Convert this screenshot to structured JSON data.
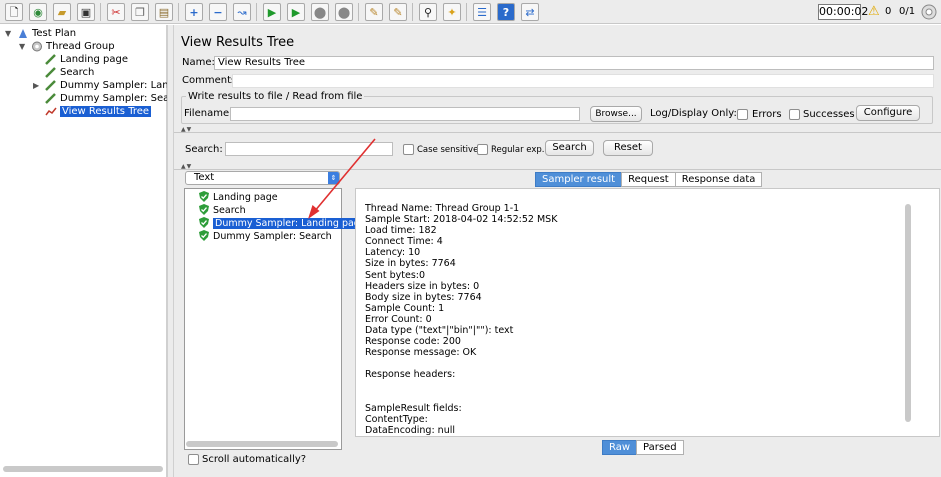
{
  "toolbar": {
    "buttons": [
      "new-icon",
      "templates-icon",
      "open-icon",
      "save-icon",
      "cut-icon",
      "copy-icon",
      "paste-icon",
      "expand-icon",
      "collapse-icon",
      "toggle-icon",
      "start-icon",
      "start-no-pause-icon",
      "stop-icon",
      "shutdown-icon",
      "clear-icon",
      "clear-all-icon",
      "search-icon",
      "reset-search-icon",
      "function-helper-icon",
      "help-icon",
      "remote-icon"
    ],
    "timer": "00:00:02",
    "warnings": "0",
    "threads": "0/1"
  },
  "tree": {
    "items": [
      {
        "label": "Test Plan",
        "icon": "test-plan-icon"
      },
      {
        "label": "Thread Group",
        "icon": "thread-group-icon"
      },
      {
        "label": "Landing page",
        "icon": "sampler-icon"
      },
      {
        "label": "Search",
        "icon": "sampler-icon"
      },
      {
        "label": "Dummy Sampler: Landing",
        "icon": "sampler-icon"
      },
      {
        "label": "Dummy Sampler: Search",
        "icon": "sampler-icon"
      },
      {
        "label": "View Results Tree",
        "icon": "listener-icon"
      }
    ]
  },
  "panel": {
    "title": "View Results Tree",
    "name_label": "Name:",
    "name_value": "View Results Tree",
    "comments_label": "Comments:",
    "comments_value": "",
    "write_legend": "Write results to file / Read from file",
    "filename_label": "Filename",
    "filename_value": "",
    "browse": "Browse...",
    "log_display_label": "Log/Display Only:",
    "errors_label": "Errors",
    "successes_label": "Successes",
    "configure": "Configure"
  },
  "search": {
    "label": "Search:",
    "value": "",
    "case_sensitive": "Case sensitive",
    "regular_exp": "Regular exp.",
    "search_button": "Search",
    "reset_button": "Reset"
  },
  "renderer": {
    "selected": "Text"
  },
  "results": [
    {
      "label": "Landing page",
      "status": "success"
    },
    {
      "label": "Search",
      "status": "success"
    },
    {
      "label": "Dummy Sampler: Landing page",
      "status": "success",
      "selected": true
    },
    {
      "label": "Dummy Sampler: Search",
      "status": "success"
    }
  ],
  "scroll_auto": "Scroll automatically?",
  "tabs": [
    "Sampler result",
    "Request",
    "Response data"
  ],
  "details": [
    "Thread Name: Thread Group 1-1",
    "Sample Start: 2018-04-02 14:52:52 MSK",
    "Load time: 182",
    "Connect Time: 4",
    "Latency: 10",
    "Size in bytes: 7764",
    "Sent bytes:0",
    "Headers size in bytes: 0",
    "Body size in bytes: 7764",
    "Sample Count: 1",
    "Error Count: 0",
    "Data type (\"text\"|\"bin\"|\"\"): text",
    "Response code: 200",
    "Response message: OK",
    "",
    "Response headers:",
    "",
    "",
    "SampleResult fields:",
    "ContentType:",
    "DataEncoding: null"
  ],
  "view_modes": [
    "Raw",
    "Parsed"
  ],
  "colors": {
    "selection": "#1a5fd3",
    "tab_active": "#4f8fd8",
    "annotation_arrow": "#e03030",
    "success": "#2e9d3a"
  }
}
